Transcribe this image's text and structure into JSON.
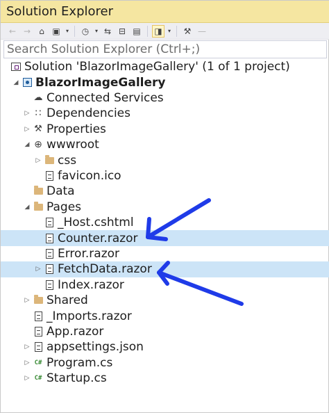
{
  "window": {
    "title": "Solution Explorer"
  },
  "search": {
    "placeholder": "Search Solution Explorer (Ctrl+;)"
  },
  "toolbar": {
    "buttons": [
      {
        "icon": "back-icon",
        "glyph": "←",
        "disabled": true
      },
      {
        "icon": "forward-icon",
        "glyph": "→",
        "disabled": true
      },
      {
        "icon": "home-icon",
        "glyph": "⌂"
      },
      {
        "icon": "switch-views-icon",
        "glyph": "▣",
        "caret": true
      },
      {
        "sep": true
      },
      {
        "icon": "pending-changes-filter-icon",
        "glyph": "◷",
        "caret": true
      },
      {
        "icon": "sync-icon",
        "glyph": "⇆"
      },
      {
        "icon": "collapse-all-icon",
        "glyph": "⊟"
      },
      {
        "icon": "show-all-files-icon",
        "glyph": "▤"
      },
      {
        "sep": true
      },
      {
        "icon": "preview-icon",
        "glyph": "◨",
        "pressed": true,
        "caret": true
      },
      {
        "sep": true
      },
      {
        "icon": "properties-wrench-icon",
        "glyph": "⚒"
      },
      {
        "icon": "pin-icon",
        "glyph": "—",
        "disabled": true
      }
    ]
  },
  "tree": [
    {
      "label": "Solution 'BlazorImageGallery' (1 of 1 project)",
      "indent": 0,
      "expander": "",
      "icon": "solution-icon"
    },
    {
      "label": "BlazorImageGallery",
      "indent": 1,
      "expander": "◢",
      "icon": "project-icon",
      "bold": true
    },
    {
      "label": "Connected Services",
      "indent": 2,
      "expander": "",
      "icon": "connected-services-icon"
    },
    {
      "label": "Dependencies",
      "indent": 2,
      "expander": "▷",
      "icon": "dependencies-icon"
    },
    {
      "label": "Properties",
      "indent": 2,
      "expander": "▷",
      "icon": "properties-icon"
    },
    {
      "label": "wwwroot",
      "indent": 2,
      "expander": "◢",
      "icon": "globe-icon"
    },
    {
      "label": "css",
      "indent": 3,
      "expander": "▷",
      "icon": "folder-icon"
    },
    {
      "label": "favicon.ico",
      "indent": 3,
      "expander": "",
      "icon": "image-file-icon"
    },
    {
      "label": "Data",
      "indent": 2,
      "expander": "",
      "icon": "folder-icon"
    },
    {
      "label": "Pages",
      "indent": 2,
      "expander": "◢",
      "icon": "folder-open-icon"
    },
    {
      "label": "_Host.cshtml",
      "indent": 3,
      "expander": "",
      "icon": "file-icon"
    },
    {
      "label": "Counter.razor",
      "indent": 3,
      "expander": "",
      "icon": "file-icon",
      "selected": true
    },
    {
      "label": "Error.razor",
      "indent": 3,
      "expander": "",
      "icon": "file-icon"
    },
    {
      "label": "FetchData.razor",
      "indent": 3,
      "expander": "▷",
      "icon": "file-icon",
      "selected": true
    },
    {
      "label": "Index.razor",
      "indent": 3,
      "expander": "",
      "icon": "file-icon"
    },
    {
      "label": "Shared",
      "indent": 2,
      "expander": "▷",
      "icon": "folder-icon"
    },
    {
      "label": "_Imports.razor",
      "indent": 2,
      "expander": "",
      "icon": "file-icon"
    },
    {
      "label": "App.razor",
      "indent": 2,
      "expander": "",
      "icon": "file-icon"
    },
    {
      "label": "appsettings.json",
      "indent": 2,
      "expander": "▷",
      "icon": "json-file-icon"
    },
    {
      "label": "Program.cs",
      "indent": 2,
      "expander": "▷",
      "icon": "csharp-file-icon"
    },
    {
      "label": "Startup.cs",
      "indent": 2,
      "expander": "▷",
      "icon": "csharp-file-icon"
    }
  ],
  "colors": {
    "title_bar": "#f5e6a1",
    "selection": "#cce4f7",
    "annotation_arrow": "#1f3be8"
  }
}
